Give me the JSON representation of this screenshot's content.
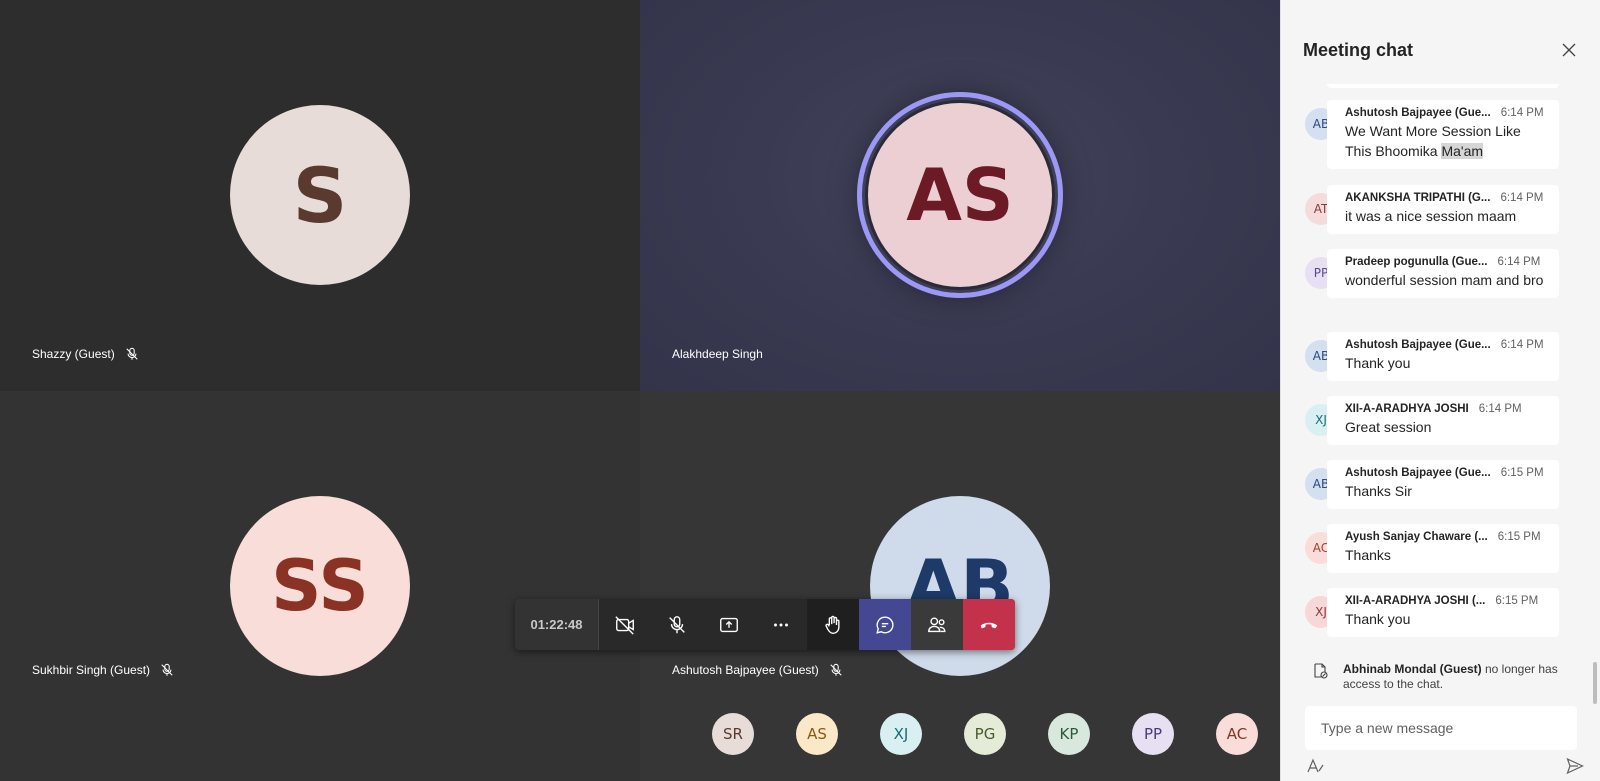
{
  "tiles": [
    {
      "initials": "S",
      "name": "Shazzy (Guest)",
      "muted": true
    },
    {
      "initials": "AS",
      "name": "Alakhdeep Singh",
      "muted": false
    },
    {
      "initials": "SS",
      "name": "Sukhbir Singh (Guest)",
      "muted": true
    },
    {
      "initials": "AB",
      "name": "Ashutosh Bajpayee (Guest)",
      "muted": true
    }
  ],
  "controls": {
    "timer": "01:22:48",
    "icons": [
      "camera-off-icon",
      "mic-off-icon",
      "share-screen-icon",
      "more-options-icon",
      "raise-hand-icon",
      "chat-icon",
      "participants-icon",
      "hang-up-icon"
    ]
  },
  "attendees": [
    {
      "initials": "SR",
      "bg": "#e8dcd8",
      "fg": "#5a3a2e"
    },
    {
      "initials": "AS",
      "bg": "#fbe8c8",
      "fg": "#8a5a12"
    },
    {
      "initials": "XJ",
      "bg": "#d8f0f2",
      "fg": "#1d6a74"
    },
    {
      "initials": "PG",
      "bg": "#e4ecd8",
      "fg": "#4a5a2a"
    },
    {
      "initials": "KP",
      "bg": "#d8e8dc",
      "fg": "#2a5a3a"
    },
    {
      "initials": "PP",
      "bg": "#e6e0f2",
      "fg": "#4a3a7a"
    },
    {
      "initials": "AC",
      "bg": "#f9ddd8",
      "fg": "#8a3224"
    }
  ],
  "chat": {
    "title": "Meeting chat",
    "messages": [
      {
        "initials": "AB",
        "sender": "Ashutosh Bajpayee (Gue...",
        "time": "6:14 PM",
        "text_a": "We Want More Session Like This Bhoomika ",
        "text_b": "Ma'am",
        "bg": "#d4dff0",
        "fg": "#2a4a7a"
      },
      {
        "initials": "AT",
        "sender": "AKANKSHA TRIPATHI (G...",
        "time": "6:14 PM",
        "text": "it was a nice session maam",
        "bg": "#f4dcdc",
        "fg": "#8a3a3a"
      },
      {
        "initials": "PP",
        "sender": "Pradeep pogunulla (Gue...",
        "time": "6:14 PM",
        "text": "wonderful session mam and bro",
        "bg": "#e6e0f2",
        "fg": "#5a4a8a"
      },
      {
        "initials": "AB",
        "sender": "Ashutosh Bajpayee (Gue...",
        "time": "6:14 PM",
        "text": "Thank you",
        "bg": "#d4dff0",
        "fg": "#2a4a7a"
      },
      {
        "initials": "XJ",
        "sender": "XII-A-ARADHYA JOSHI",
        "time": "6:14 PM",
        "text": "Great session",
        "bg": "#d8f0f2",
        "fg": "#1d6a74"
      },
      {
        "initials": "AB",
        "sender": "Ashutosh Bajpayee (Gue...",
        "time": "6:15 PM",
        "text": "Thanks Sir",
        "bg": "#d4dff0",
        "fg": "#2a4a7a"
      },
      {
        "initials": "AC",
        "sender": "Ayush Sanjay Chaware (...",
        "time": "6:15 PM",
        "text": "Thanks",
        "bg": "#f9ddd8",
        "fg": "#a04030"
      },
      {
        "initials": "XJ",
        "sender": "XII-A-ARADHYA JOSHI (...",
        "time": "6:15 PM",
        "text": "Thank you",
        "bg": "#f6d8d8",
        "fg": "#8a3a3a"
      }
    ],
    "notice": {
      "name": "Abhinab Mondal (Guest)",
      "text": " no longer has access to the chat."
    },
    "compose_placeholder": "Type a new message"
  }
}
